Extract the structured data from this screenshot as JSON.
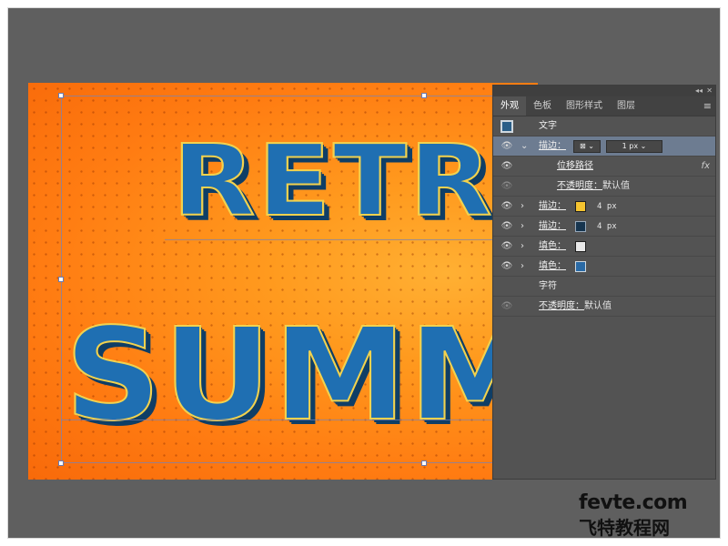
{
  "artwork": {
    "line1": "RETR",
    "line2": "SUMM"
  },
  "panel": {
    "tabs": [
      {
        "label": "外观"
      },
      {
        "label": "色板"
      },
      {
        "label": "图形样式"
      },
      {
        "label": "图层"
      }
    ],
    "menu_icon": "hamburger-menu-icon",
    "title_row": {
      "label": "文字"
    },
    "stroke_selected": {
      "label": "描边：",
      "weight_value": "1 px"
    },
    "offset_path": {
      "label": "位移路径",
      "fx": "fx"
    },
    "opacity_inner": {
      "label": "不透明度：",
      "value": "默认值"
    },
    "stroke_yellow": {
      "label": "描边：",
      "value": "4 px",
      "color": "#f5c430"
    },
    "stroke_dark": {
      "label": "描边：",
      "value": "4 px",
      "color": "#17354f"
    },
    "fill_white": {
      "label": "填色：",
      "color": "#e8e8e8"
    },
    "fill_blue": {
      "label": "填色：",
      "color": "#2a6aa5"
    },
    "characters": {
      "label": "字符"
    },
    "opacity_outer": {
      "label": "不透明度：",
      "value": "默认值"
    }
  },
  "watermark": {
    "line1": "fevte.com",
    "line2": "飞特教程网"
  },
  "colors": {
    "canvas_bg": "#5f5f5f",
    "artboard_orange": "#ff9a1e",
    "text_blue": "#1f6fb2",
    "text_outline": "#f2d24e"
  }
}
